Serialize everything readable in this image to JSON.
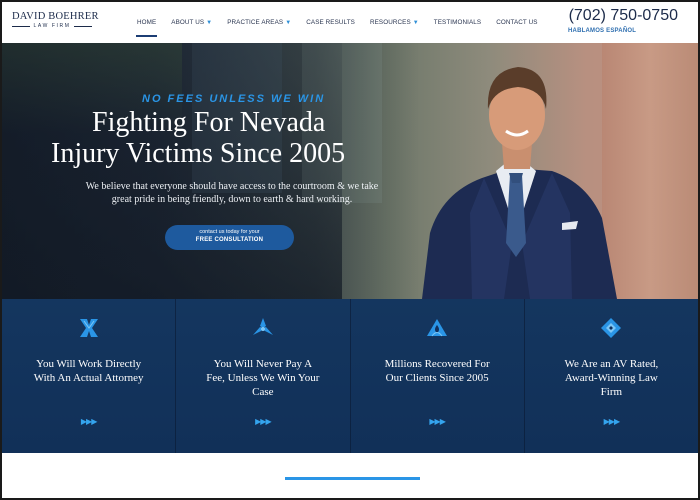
{
  "header": {
    "logo_name": "DAVID BOEHRER",
    "logo_sub": "LAW FIRM",
    "nav": [
      {
        "label": "HOME",
        "caret": ""
      },
      {
        "label": "ABOUT US",
        "caret": "▼"
      },
      {
        "label": "PRACTICE AREAS",
        "caret": "▼"
      },
      {
        "label": "CASE RESULTS",
        "caret": ""
      },
      {
        "label": "RESOURCES",
        "caret": "▼"
      },
      {
        "label": "TESTIMONIALS",
        "caret": ""
      },
      {
        "label": "CONTACT US",
        "caret": ""
      }
    ],
    "phone": "(702) 750-0750",
    "hablamos": "HABLAMOS ESPAÑOL"
  },
  "hero": {
    "tagline": "NO FEES UNLESS WE WIN",
    "headline_line1": "Fighting For Nevada",
    "headline_line2": "Injury Victims Since 2005",
    "subtext": "We believe that everyone should have access to the courtroom & we take great pride in being friendly, down to earth & hard working.",
    "cta_line1": "contact us today for your",
    "cta_line2": "FREE CONSULTATION"
  },
  "features": [
    {
      "icon": "x-cross-icon",
      "text": "You Will Work Directly With An Actual Attorney",
      "arrows": "▶▶▶"
    },
    {
      "icon": "tri-blade-icon",
      "text": "You Will Never Pay A Fee, Unless We Win Your Case",
      "arrows": "▶▶▶"
    },
    {
      "icon": "triangle-swirl-icon",
      "text": "Millions Recovered For Our Clients Since 2005",
      "arrows": "▶▶▶"
    },
    {
      "icon": "diamond-icon",
      "text": "We Are an AV Rated, Award-Winning Law Firm",
      "arrows": "▶▶▶"
    }
  ],
  "colors": {
    "navy": "#12305c",
    "accent_blue": "#2a95e6",
    "cta_blue": "#1e5a9e"
  }
}
